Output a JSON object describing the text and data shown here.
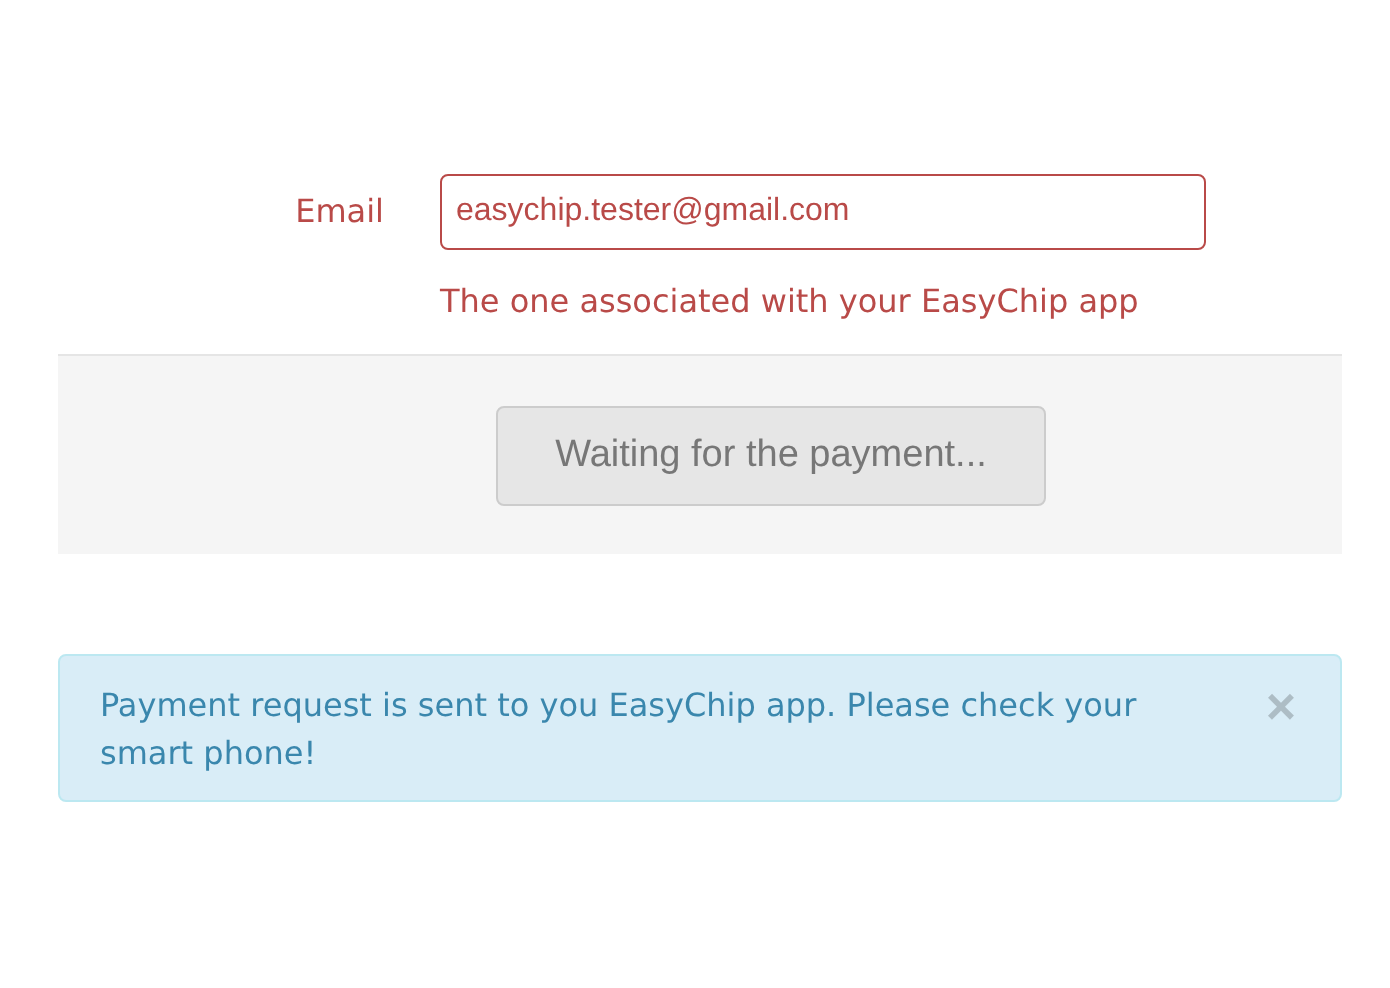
{
  "form": {
    "field": {
      "label": "Email",
      "value": "easychip.tester@gmail.com",
      "help": "The one associated with your EasyChip app",
      "error": true
    },
    "submit_button": {
      "label": "Waiting for the payment...",
      "disabled": true
    }
  },
  "alert": {
    "message": "Payment request is sent to you EasyChip app. Please check your smart phone!",
    "close": "×"
  }
}
